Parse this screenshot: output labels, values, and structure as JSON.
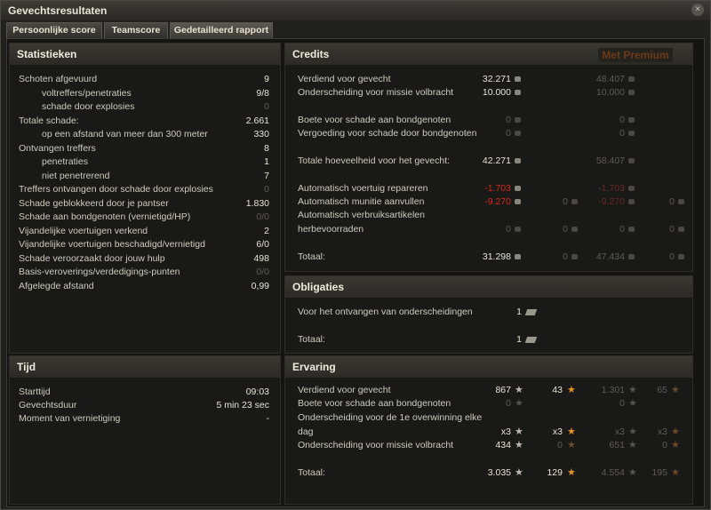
{
  "window": {
    "title": "Gevechtsresultaten"
  },
  "tabs": [
    {
      "label": "Persoonlijke score"
    },
    {
      "label": "Teamscore"
    },
    {
      "label": "Gedetailleerd rapport"
    }
  ],
  "stats": {
    "heading": "Statistieken",
    "rows": [
      {
        "label": "Schoten afgevuurd",
        "value": "9"
      },
      {
        "label": "voltreffers/penetraties",
        "value": "9/8"
      },
      {
        "label": "schade door explosies",
        "value": "0"
      },
      {
        "label": "Totale schade:",
        "value": "2.661"
      },
      {
        "label": "op een afstand van meer dan 300 meter",
        "value": "330"
      },
      {
        "label": "Ontvangen treffers",
        "value": "8"
      },
      {
        "label": "penetraties",
        "value": "1"
      },
      {
        "label": "niet penetrerend",
        "value": "7"
      },
      {
        "label": "Treffers ontvangen door schade door explosies",
        "value": "0"
      },
      {
        "label": "Schade geblokkeerd door je pantser",
        "value": "1.830"
      },
      {
        "label": "Schade aan bondgenoten (vernietigd/HP)",
        "value": "0/0"
      },
      {
        "label": "Vijandelijke voertuigen verkend",
        "value": "2"
      },
      {
        "label": "Vijandelijke voertuigen beschadigd/vernietigd",
        "value": "6/0"
      },
      {
        "label": "Schade veroorzaakt door jouw hulp",
        "value": "498"
      },
      {
        "label": "Basis-veroverings/verdedigings-punten",
        "value": "0/0"
      },
      {
        "label": "Afgelegde afstand",
        "value": "0,99"
      }
    ]
  },
  "time": {
    "heading": "Tijd",
    "rows": [
      {
        "label": "Starttijd",
        "value": "09:03"
      },
      {
        "label": "Gevechtsduur",
        "value": "5 min 23 sec"
      },
      {
        "label": "Moment van vernietiging",
        "value": "-"
      }
    ]
  },
  "credits": {
    "heading": "Credits",
    "premium_label": "Met Premium",
    "rows": [
      {
        "label": "Verdiend voor gevecht",
        "v1": "32.271",
        "v3": "48.407"
      },
      {
        "label": "Onderscheiding voor missie volbracht",
        "v1": "10.000",
        "v3": "10.000"
      },
      {
        "label": "Boete voor schade aan bondgenoten",
        "v1": "0",
        "v3": "0"
      },
      {
        "label": "Vergoeding voor schade door bondgenoten",
        "v1": "0",
        "v3": "0"
      },
      {
        "label": "Totale hoeveelheid voor het gevecht:",
        "v1": "42.271",
        "v3": "58.407"
      },
      {
        "label": "Automatisch voertuig repareren",
        "v1": "-1.703",
        "v3": "-1.703"
      },
      {
        "label": "Automatisch munitie aanvullen",
        "v1": "-9.270",
        "v2": "0",
        "v3": "-9.270",
        "v4": "0"
      },
      {
        "label": "Automatisch verbruiksartikelen",
        "v1": "",
        "v3": ""
      },
      {
        "label": "herbevoorraden",
        "v1": "0",
        "v2": "0",
        "v3": "0",
        "v4": "0"
      },
      {
        "label": "Totaal:",
        "v1": "31.298",
        "v2": "0",
        "v3": "47.434",
        "v4": "0"
      }
    ]
  },
  "bonds": {
    "heading": "Obligaties",
    "rows": [
      {
        "label": "Voor het ontvangen van onderscheidingen",
        "value": "1"
      },
      {
        "label": "Totaal:",
        "value": "1"
      }
    ]
  },
  "xp": {
    "heading": "Ervaring",
    "rows": [
      {
        "label": "Verdiend voor gevecht",
        "v1": "867",
        "v2": "43",
        "v3": "1.301",
        "v4": "65"
      },
      {
        "label": "Boete voor schade aan bondgenoten",
        "v1": "0",
        "v3": "0"
      },
      {
        "label": "Onderscheiding voor de 1e overwinning elke",
        "v1": "",
        "v3": ""
      },
      {
        "label": "dag",
        "v1": "x3",
        "v2": "x3",
        "v3": "x3",
        "v4": "x3"
      },
      {
        "label": "Onderscheiding voor missie volbracht",
        "v1": "434",
        "v2": "0",
        "v3": "651",
        "v4": "0"
      },
      {
        "label": "Totaal:",
        "v1": "3.035",
        "v2": "129",
        "v3": "4.554",
        "v4": "195"
      }
    ]
  }
}
